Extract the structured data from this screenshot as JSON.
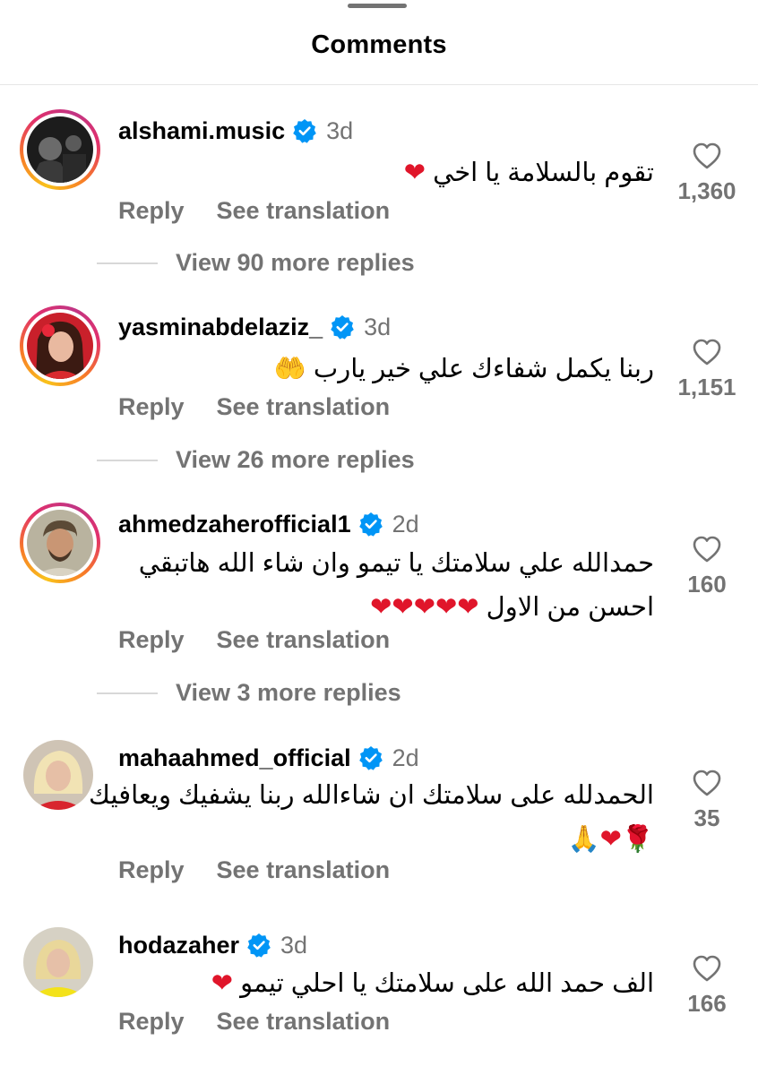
{
  "sheet": {
    "title": "Comments"
  },
  "comments": [
    {
      "username": "alshami.music",
      "verified": true,
      "time": "3d",
      "text_lines": [
        "تقوم بالسلامة يا اخي"
      ],
      "emoji_line": "❤",
      "reply_label": "Reply",
      "translate_label": "See translation",
      "like_count": "1,360",
      "view_replies": "View 90 more replies"
    },
    {
      "username": "yasminabdelaziz_",
      "verified": true,
      "time": "3d",
      "text_lines": [
        "ربنا يكمل شفاءك علي خير  يارب"
      ],
      "emoji_line": "🤲",
      "reply_label": "Reply",
      "translate_label": "See translation",
      "like_count": "1,151",
      "view_replies": "View 26 more replies"
    },
    {
      "username": "ahmedzaherofficial1",
      "verified": true,
      "time": "2d",
      "text_lines": [
        "حمدالله علي سلامتك يا تيمو وان شاء الله هاتبقي",
        "احسن من الاول"
      ],
      "emoji_line": "❤❤❤❤❤",
      "reply_label": "Reply",
      "translate_label": "See translation",
      "like_count": "160",
      "view_replies": "View 3 more replies"
    },
    {
      "username": "mahaahmed_official",
      "verified": true,
      "time": "2d",
      "text_lines": [
        "الحمدلله على سلامتك ان شاءالله ربنا يشفيك ويعافيك"
      ],
      "emoji_line": "🌹❤🙏",
      "reply_label": "Reply",
      "translate_label": "See translation",
      "like_count": "35",
      "view_replies": ""
    },
    {
      "username": "hodazaher",
      "verified": true,
      "time": "3d",
      "text_lines": [
        "الف حمد الله على سلامتك يا احلي تيمو"
      ],
      "emoji_line": "❤",
      "reply_label": "Reply",
      "translate_label": "See translation",
      "like_count": "166",
      "view_replies": ""
    }
  ],
  "colors": {
    "text_primary": "#000000",
    "text_secondary": "#737373",
    "verified_blue": "#0095f6",
    "heart_red": "#e0152a",
    "divider": "#e6e6e6"
  },
  "icons": {
    "verified": "verified-badge-icon",
    "like": "heart-outline-icon",
    "handle": "drag-handle"
  }
}
